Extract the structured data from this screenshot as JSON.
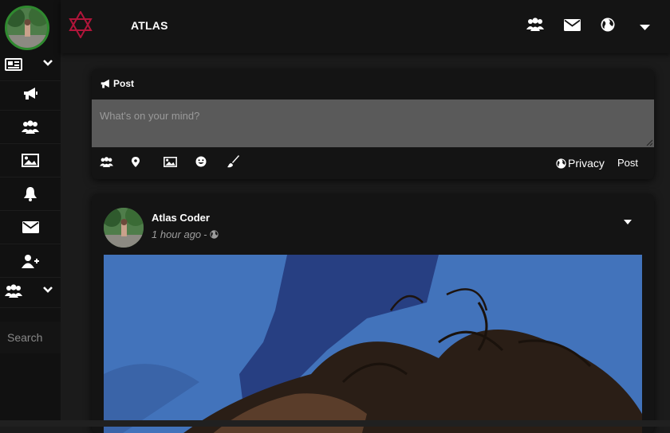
{
  "app": {
    "title": "ATLAS",
    "accent": "#b0153a"
  },
  "sidebar": {
    "items": [
      {
        "icon": "newspaper-icon",
        "has_caret": true
      },
      {
        "icon": "megaphone-icon",
        "has_caret": false
      },
      {
        "icon": "users-icon",
        "has_caret": false
      },
      {
        "icon": "image-icon",
        "has_caret": false
      },
      {
        "icon": "bell-icon",
        "has_caret": false
      },
      {
        "icon": "envelope-icon",
        "has_caret": false
      },
      {
        "icon": "user-plus-icon",
        "has_caret": false
      },
      {
        "icon": "users-icon",
        "has_caret": true
      }
    ],
    "search_label": "Search"
  },
  "header": {
    "icons": [
      "users-icon",
      "envelope-icon",
      "globe-icon",
      "caret-down-icon"
    ]
  },
  "composer": {
    "heading": "Post",
    "placeholder": "What's on your mind?",
    "tools": [
      "users-icon",
      "map-pin-icon",
      "image-icon",
      "smile-icon",
      "brush-icon"
    ],
    "privacy_label": "Privacy",
    "post_label": "Post"
  },
  "post": {
    "author": "Atlas Coder",
    "time": "1 hour ago",
    "separator": "-"
  },
  "colors": {
    "background": "#1b1b1b",
    "card": "#141414",
    "sidebar": "#111111",
    "textarea": "#5a5a5a",
    "avatar_ring": "#2f8a2f",
    "photo_blue": "#3f6fb5"
  }
}
